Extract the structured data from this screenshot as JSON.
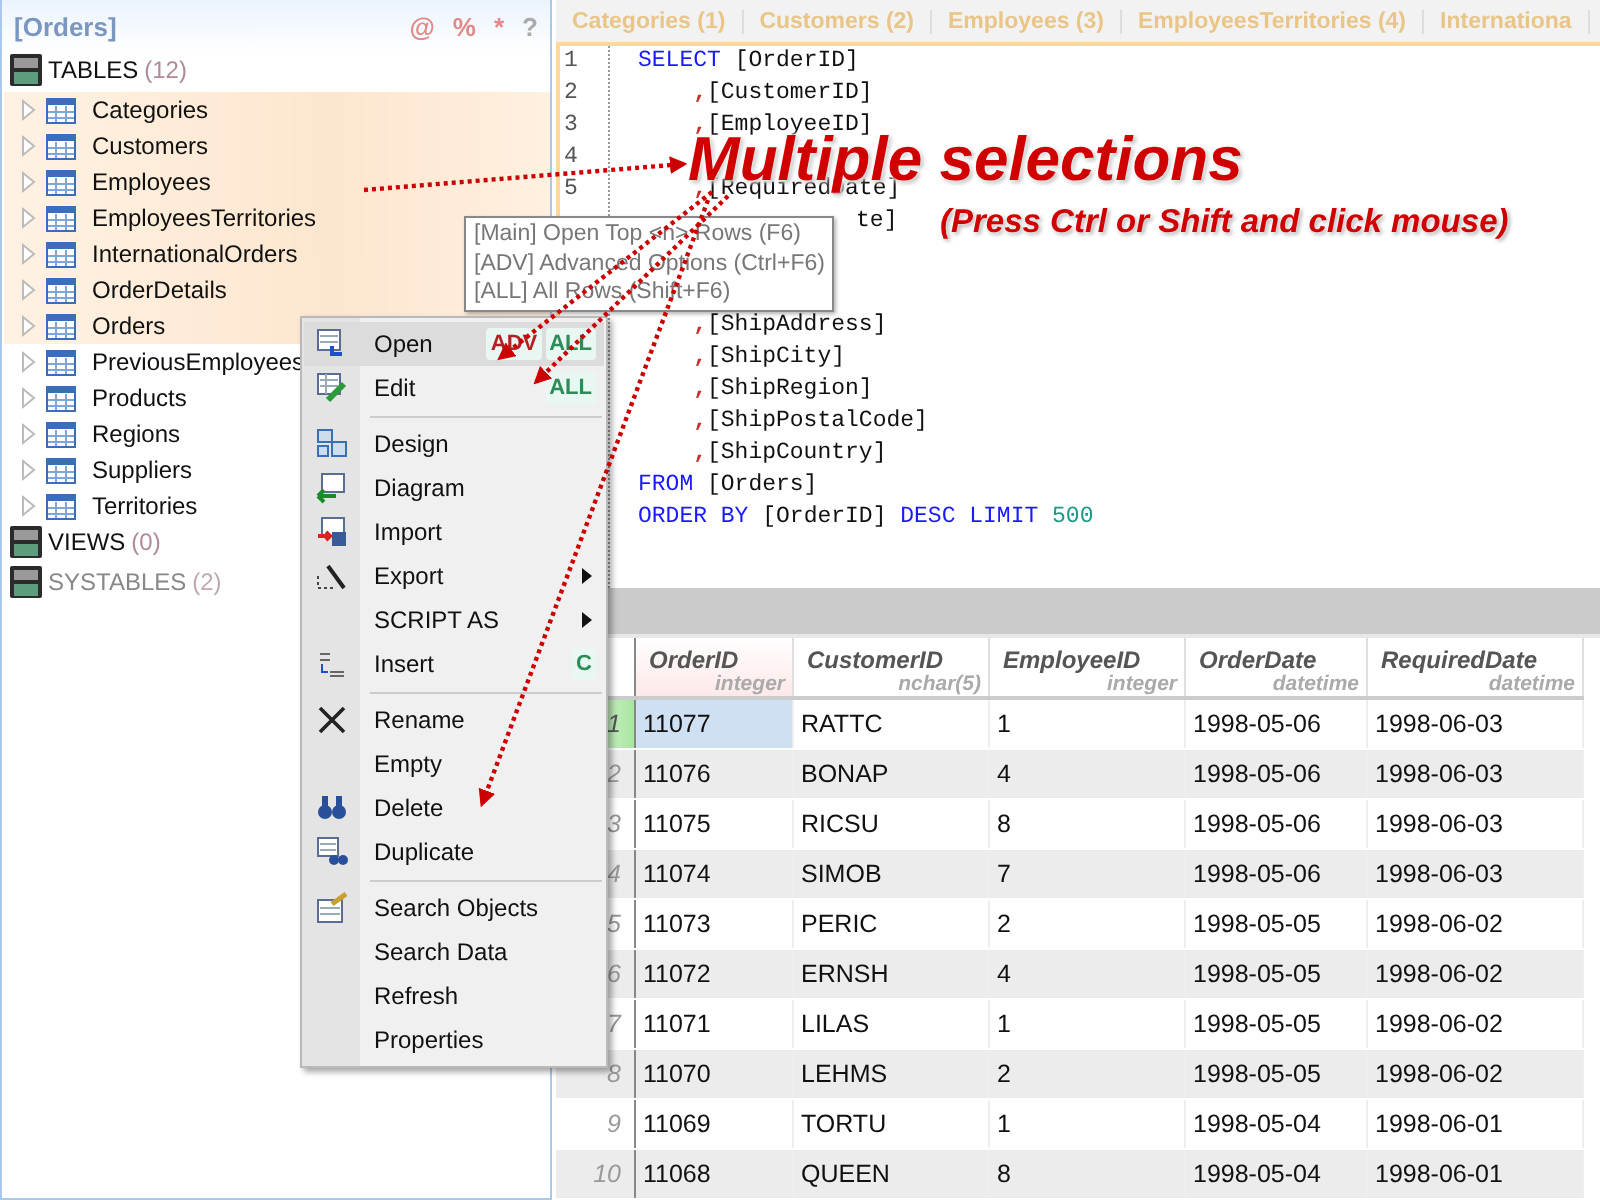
{
  "panel": {
    "title": "[Orders]",
    "tools": [
      "@",
      "%",
      "*",
      "?"
    ]
  },
  "tree": [
    {
      "label": "TABLES",
      "count": "(12)",
      "disabled": false,
      "children": [
        {
          "label": "Categories",
          "selected": true
        },
        {
          "label": "Customers",
          "selected": true
        },
        {
          "label": "Employees",
          "selected": true
        },
        {
          "label": "EmployeesTerritories",
          "selected": true
        },
        {
          "label": "InternationalOrders",
          "selected": true
        },
        {
          "label": "OrderDetails",
          "selected": true
        },
        {
          "label": "Orders",
          "selected": true
        },
        {
          "label": "PreviousEmployees",
          "selected": false
        },
        {
          "label": "Products",
          "selected": false
        },
        {
          "label": "Regions",
          "selected": false
        },
        {
          "label": "Suppliers",
          "selected": false
        },
        {
          "label": "Territories",
          "selected": false
        }
      ]
    },
    {
      "label": "VIEWS",
      "count": "(0)",
      "disabled": false
    },
    {
      "label": "SYSTABLES",
      "count": "(2)",
      "disabled": true
    }
  ],
  "tabs": [
    "Categories (1)",
    "Customers (2)",
    "Employees (3)",
    "EmployeesTerritories (4)",
    "Internationa"
  ],
  "editor": {
    "lines": [
      {
        "n": "1",
        "tokens": [
          {
            "kind": "keyword",
            "t": "SELECT"
          },
          {
            "kind": "name",
            "t": "[OrderID]"
          }
        ]
      },
      {
        "n": "2",
        "tokens": [
          {
            "kind": "comma",
            "t": ","
          },
          {
            "kind": "name",
            "t": "[CustomerID]"
          }
        ]
      },
      {
        "n": "3",
        "tokens": [
          {
            "kind": "comma",
            "t": ","
          },
          {
            "kind": "name",
            "t": "[EmployeeID]"
          }
        ]
      },
      {
        "n": "4"
      },
      {
        "n": "5",
        "tokens": [
          {
            "kind": "comma",
            "t": ","
          },
          {
            "kind": "name",
            "t": "[RequiredDate]"
          }
        ]
      },
      {
        "tokens": [
          {
            "kind": "tail",
            "t": "te]"
          }
        ]
      }
    ],
    "lines_below_tooltip": [
      {
        "tokens": [
          {
            "kind": "comma",
            "t": ","
          },
          {
            "kind": "name",
            "t": "[ShipAddress]"
          }
        ]
      },
      {
        "tokens": [
          {
            "kind": "comma",
            "t": ","
          },
          {
            "kind": "name",
            "t": "[ShipCity]"
          }
        ]
      },
      {
        "tokens": [
          {
            "kind": "comma",
            "t": ","
          },
          {
            "kind": "name",
            "t": "[ShipRegion]"
          }
        ]
      },
      {
        "tokens": [
          {
            "kind": "comma",
            "t": ","
          },
          {
            "kind": "name",
            "t": "[ShipPostalCode]"
          }
        ]
      },
      {
        "tokens": [
          {
            "kind": "comma",
            "t": ","
          },
          {
            "kind": "name",
            "t": "[ShipCountry]"
          }
        ]
      },
      {
        "tokens": [
          {
            "kind": "keyword",
            "t": "FROM"
          },
          {
            "kind": "name",
            "t": "[Orders]"
          }
        ]
      },
      {
        "tokens": [
          {
            "kind": "keyword",
            "t": "ORDER BY"
          },
          {
            "kind": "name",
            "t": "[OrderID]"
          },
          {
            "kind": "keyword",
            "t": "DESC LIMIT"
          },
          {
            "kind": "number",
            "t": "500"
          }
        ]
      }
    ]
  },
  "annotation": {
    "title": "Multiple selections",
    "hint": "(Press Ctrl or Shift and click mouse)"
  },
  "tooltip": {
    "lines": [
      "[Main] Open Top <n> Rows (F6)",
      "[ADV] Advanced Options (Ctrl+F6)",
      "[ALL] All Rows (Shift+F6)"
    ]
  },
  "context_menu": {
    "items": [
      {
        "kind": "item",
        "label": "Open",
        "hovered": true,
        "badges": [
          {
            "text": "ADV",
            "color": "#b22222"
          },
          {
            "text": "ALL",
            "color": "#2e8b57"
          }
        ]
      },
      {
        "kind": "item",
        "label": "Edit",
        "hovered": false,
        "badges": [
          {
            "text": "ALL",
            "color": "#2e8b57"
          }
        ]
      },
      {
        "kind": "separator"
      },
      {
        "kind": "item",
        "label": "Design",
        "hovered": false
      },
      {
        "kind": "item",
        "label": "Diagram",
        "hovered": false
      },
      {
        "kind": "item",
        "label": "Import",
        "hovered": false
      },
      {
        "kind": "item",
        "label": "Export",
        "hovered": false,
        "submenu": true
      },
      {
        "kind": "item",
        "label": "SCRIPT AS",
        "hovered": false,
        "submenu": true
      },
      {
        "kind": "item",
        "label": "Insert",
        "hovered": false,
        "badges": [
          {
            "text": "C",
            "color": "#2e8b57"
          }
        ]
      },
      {
        "kind": "separator"
      },
      {
        "kind": "item",
        "label": "Rename",
        "hovered": false
      },
      {
        "kind": "item",
        "label": "Empty",
        "hovered": false
      },
      {
        "kind": "item",
        "label": "Delete",
        "hovered": false
      },
      {
        "kind": "item",
        "label": "Duplicate",
        "hovered": false
      },
      {
        "kind": "separator"
      },
      {
        "kind": "item",
        "label": "Search Objects",
        "hovered": false
      },
      {
        "kind": "item",
        "label": "Search Data",
        "hovered": false
      },
      {
        "kind": "item",
        "label": "Refresh",
        "hovered": false
      },
      {
        "kind": "item",
        "label": "Properties",
        "hovered": false
      }
    ]
  },
  "grid": {
    "columns": [
      {
        "name": "OrderID",
        "type": "integer"
      },
      {
        "name": "CustomerID",
        "type": "nchar(5)"
      },
      {
        "name": "EmployeeID",
        "type": "integer"
      },
      {
        "name": "OrderDate",
        "type": "datetime"
      },
      {
        "name": "RequiredDate",
        "type": "datetime"
      }
    ],
    "rows": [
      {
        "number": "1",
        "selected": true,
        "cells": [
          "11077",
          "RATTC",
          "1",
          "1998-05-06",
          "1998-06-03"
        ]
      },
      {
        "number": "2",
        "selected": false,
        "cells": [
          "11076",
          "BONAP",
          "4",
          "1998-05-06",
          "1998-06-03"
        ]
      },
      {
        "number": "3",
        "selected": false,
        "cells": [
          "11075",
          "RICSU",
          "8",
          "1998-05-06",
          "1998-06-03"
        ]
      },
      {
        "number": "4",
        "selected": false,
        "cells": [
          "11074",
          "SIMOB",
          "7",
          "1998-05-06",
          "1998-06-03"
        ]
      },
      {
        "number": "5",
        "selected": false,
        "cells": [
          "11073",
          "PERIC",
          "2",
          "1998-05-05",
          "1998-06-02"
        ]
      },
      {
        "number": "6",
        "selected": false,
        "cells": [
          "11072",
          "ERNSH",
          "4",
          "1998-05-05",
          "1998-06-02"
        ]
      },
      {
        "number": "7",
        "selected": false,
        "cells": [
          "11071",
          "LILAS",
          "1",
          "1998-05-05",
          "1998-06-02"
        ]
      },
      {
        "number": "8",
        "selected": false,
        "cells": [
          "11070",
          "LEHMS",
          "2",
          "1998-05-05",
          "1998-06-02"
        ]
      },
      {
        "number": "9",
        "selected": false,
        "cells": [
          "11069",
          "TORTU",
          "1",
          "1998-05-04",
          "1998-06-01"
        ]
      },
      {
        "number": "10",
        "selected": false,
        "cells": [
          "11068",
          "QUEEN",
          "8",
          "1998-05-04",
          "1998-06-01"
        ]
      }
    ]
  }
}
